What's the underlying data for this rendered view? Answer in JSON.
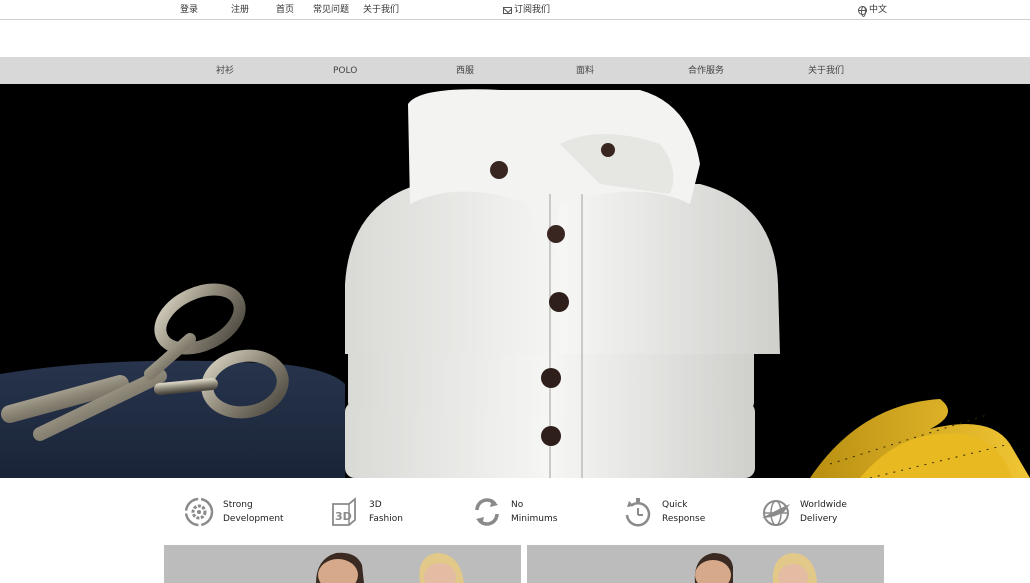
{
  "topbar": {
    "login": "登录",
    "register": "注册",
    "home": "首页",
    "faq": "常见问题",
    "about": "关于我们",
    "subscribe": "订阅我们",
    "language": "中文"
  },
  "nav": {
    "items": [
      "衬衫",
      "POLO",
      "西服",
      "面料",
      "合作服务",
      "关于我们"
    ]
  },
  "features": [
    {
      "line1": "Strong",
      "line2": "Development",
      "icon": "gear-cycle-icon"
    },
    {
      "line1": "3D",
      "line2": "Fashion",
      "icon": "3d-cube-icon"
    },
    {
      "line1": "No",
      "line2": "Minimums",
      "icon": "refresh-cycle-icon"
    },
    {
      "line1": "Quick",
      "line2": "Response",
      "icon": "stopwatch-cycle-icon"
    },
    {
      "line1": "Worldwide",
      "line2": "Delivery",
      "icon": "globe-plane-icon"
    }
  ],
  "colors": {
    "navbar_bg": "#d8d8d8",
    "hero_bg": "#000000",
    "icon_gray": "#8a8a8a"
  }
}
